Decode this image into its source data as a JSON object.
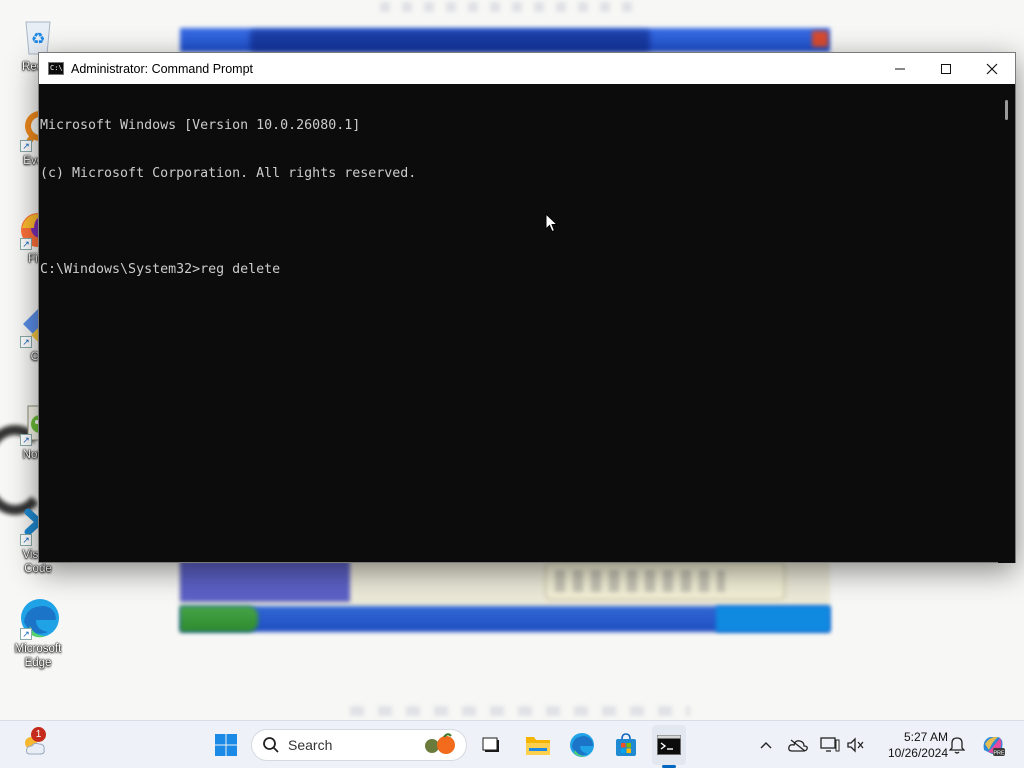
{
  "desktop": {
    "icons": [
      {
        "label": "Recycle Bin",
        "shown": "Recyc",
        "icon": "recycle-bin-icon"
      },
      {
        "label": "Everything",
        "shown": "Every",
        "icon": "everything-search-icon"
      },
      {
        "label": "Firefox",
        "shown": "Fire",
        "icon": "firefox-icon"
      },
      {
        "label": "Git Bash",
        "shown": "Git",
        "icon": "git-icon"
      },
      {
        "label": "Notepad++",
        "shown": "Notep",
        "icon": "notepad-plus-plus-icon"
      },
      {
        "label": "Visual Studio Code",
        "shown_line1": "Visual",
        "shown_line2": "Code",
        "icon": "vscode-icon"
      },
      {
        "label": "Microsoft Edge",
        "shown_line1": "Microsoft",
        "shown_line2": "Edge",
        "icon": "edge-icon"
      }
    ]
  },
  "window": {
    "title": "Administrator: Command Prompt",
    "controls": {
      "minimize": "—",
      "maximize": "☐",
      "close": "✕"
    },
    "console_lines": [
      "Microsoft Windows [Version 10.0.26080.1]",
      "(c) Microsoft Corporation. All rights reserved.",
      "",
      "C:\\Windows\\System32>reg delete"
    ]
  },
  "taskbar": {
    "search_placeholder": "Search",
    "notification_count": "1",
    "time": "5:27 AM",
    "date": "10/26/2024",
    "pinned": [
      "start-icon",
      "task-view-icon",
      "file-explorer-icon",
      "edge-icon",
      "microsoft-store-icon",
      "terminal-icon"
    ],
    "tray": [
      "chevron-up-icon",
      "onedrive-icon",
      "network-icon",
      "volume-muted-icon",
      "notification-icon",
      "copilot-icon"
    ]
  },
  "colors": {
    "console_bg": "#0c0c0c",
    "console_fg": "#cccccc",
    "taskbar_bg": "#eef2f8",
    "accent": "#0067c0"
  }
}
